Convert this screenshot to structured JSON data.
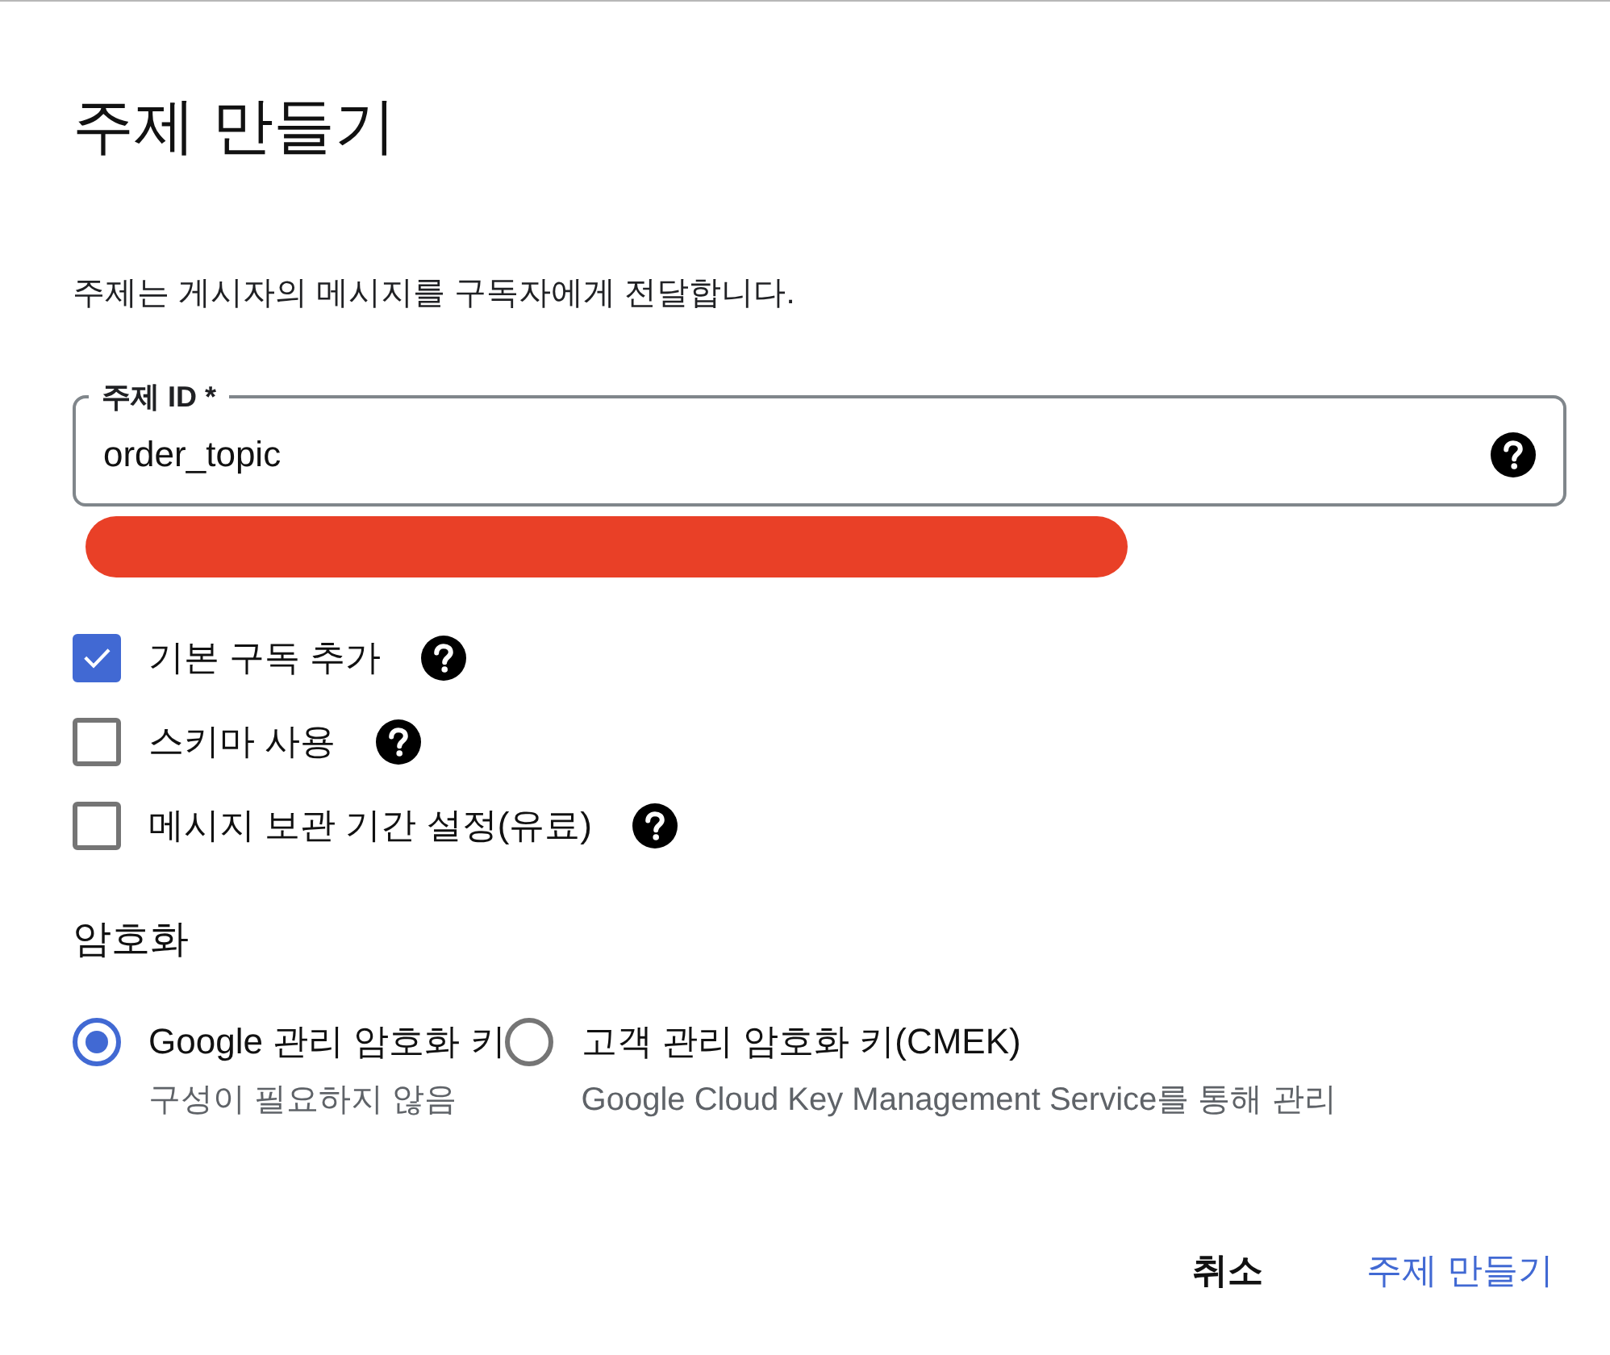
{
  "dialog": {
    "title": "주제 만들기",
    "description": "주제는 게시자의 메시지를 구독자에게 전달합니다."
  },
  "topic_id_field": {
    "label": "주제 ID *",
    "value": "order_topic",
    "helper_redacted": true
  },
  "options": [
    {
      "label": "기본 구독 추가",
      "checked": true
    },
    {
      "label": "스키마 사용",
      "checked": false
    },
    {
      "label": "메시지 보관 기간 설정(유료)",
      "checked": false
    }
  ],
  "encryption": {
    "heading": "암호화",
    "choices": [
      {
        "label": "Google 관리 암호화 키",
        "description": "구성이 필요하지 않음",
        "selected": true
      },
      {
        "label": "고객 관리 암호화 키(CMEK)",
        "description": "Google Cloud Key Management Service를 통해 관리",
        "selected": false
      }
    ]
  },
  "buttons": [
    {
      "label": "취소",
      "kind": "text"
    },
    {
      "label": "주제 만들기",
      "kind": "primary"
    }
  ]
}
